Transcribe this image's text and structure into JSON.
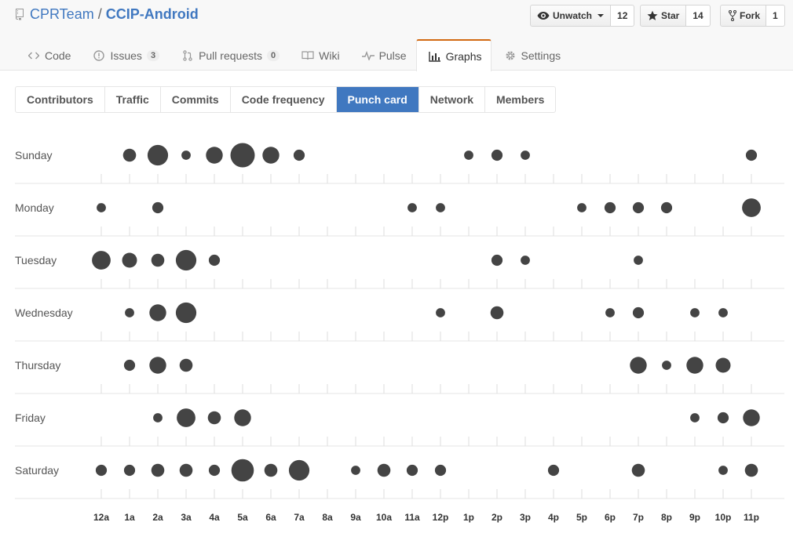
{
  "repo": {
    "owner": "CPRTeam",
    "separator": "/",
    "name": "CCIP-Android"
  },
  "actions": {
    "watch": {
      "label": "Unwatch",
      "count": "12"
    },
    "star": {
      "label": "Star",
      "count": "14"
    },
    "fork": {
      "label": "Fork",
      "count": "1"
    }
  },
  "nav": {
    "code": "Code",
    "issues": "Issues",
    "issues_count": "3",
    "pulls": "Pull requests",
    "pulls_count": "0",
    "wiki": "Wiki",
    "pulse": "Pulse",
    "graphs": "Graphs",
    "settings": "Settings"
  },
  "graph_tabs": [
    "Contributors",
    "Traffic",
    "Commits",
    "Code frequency",
    "Punch card",
    "Network",
    "Members"
  ],
  "selected_graph_tab": "Punch card",
  "colors": {
    "accent": "#4078c0",
    "dot": "#444444",
    "nav_highlight": "#d26911"
  },
  "chart_data": {
    "type": "scatter",
    "days": [
      "Sunday",
      "Monday",
      "Tuesday",
      "Wednesday",
      "Thursday",
      "Friday",
      "Saturday"
    ],
    "hours": [
      "12a",
      "1a",
      "2a",
      "3a",
      "4a",
      "5a",
      "6a",
      "7a",
      "8a",
      "9a",
      "10a",
      "11a",
      "12p",
      "1p",
      "2p",
      "3p",
      "4p",
      "5p",
      "6p",
      "7p",
      "8p",
      "9p",
      "10p",
      "11p"
    ],
    "value_scale": "relative commit volume (0-5, dot size)",
    "values": [
      [
        0,
        2,
        4,
        1,
        3,
        5,
        3,
        1.5,
        0,
        0,
        0,
        0,
        0,
        1,
        1.5,
        1,
        0,
        0,
        0,
        0,
        0,
        0,
        0,
        1.5
      ],
      [
        1,
        0,
        1.5,
        0,
        0,
        0,
        0,
        0,
        0,
        0,
        0,
        1,
        1,
        0,
        0,
        0,
        0,
        1,
        1.5,
        1.5,
        1.5,
        0,
        0,
        3.5
      ],
      [
        3.5,
        2.5,
        2,
        4,
        1.5,
        0,
        0,
        0,
        0,
        0,
        0,
        0,
        0,
        0,
        1.5,
        1,
        0,
        0,
        0,
        1,
        0,
        0,
        0,
        0
      ],
      [
        0,
        1,
        3,
        4,
        0,
        0,
        0,
        0,
        0,
        0,
        0,
        0,
        1,
        0,
        2,
        0,
        0,
        0,
        1,
        1.5,
        0,
        1,
        1,
        0
      ],
      [
        0,
        1.5,
        3,
        2,
        0,
        0,
        0,
        0,
        0,
        0,
        0,
        0,
        0,
        0,
        0,
        0,
        0,
        0,
        0,
        3,
        1,
        3,
        2.5,
        0
      ],
      [
        0,
        0,
        1,
        3.5,
        2,
        3,
        0,
        0,
        0,
        0,
        0,
        0,
        0,
        0,
        0,
        0,
        0,
        0,
        0,
        0,
        0,
        1,
        1.5,
        3
      ],
      [
        1.5,
        1.5,
        2,
        2,
        1.5,
        4.5,
        2,
        4,
        0,
        1,
        2,
        1.5,
        1.5,
        0,
        0,
        0,
        1.5,
        0,
        0,
        2,
        0,
        0,
        1,
        2
      ]
    ]
  }
}
